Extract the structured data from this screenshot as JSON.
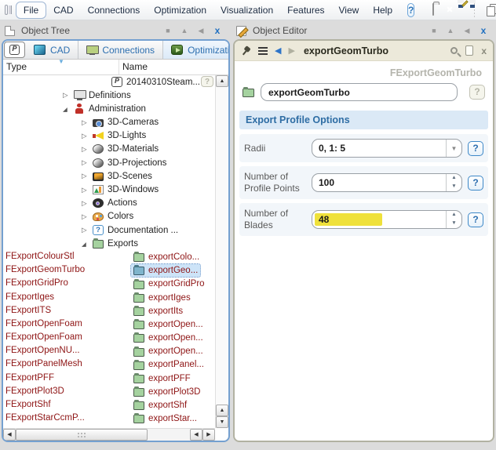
{
  "menu": {
    "items": [
      {
        "label": "File",
        "boxed": true
      },
      {
        "label": "CAD"
      },
      {
        "label": "Connections"
      },
      {
        "label": "Optimization"
      },
      {
        "label": "Visualization"
      },
      {
        "label": "Features"
      },
      {
        "label": "View"
      },
      {
        "label": "Help"
      }
    ],
    "icons": [
      "window-panel",
      "help",
      "new-project",
      "close-session",
      "save",
      "save-as",
      "copy-object"
    ]
  },
  "tree_panel": {
    "title": "Object Tree",
    "tabs": [
      {
        "label": "",
        "icon": "project-p"
      },
      {
        "label": "CAD",
        "icon": "cad"
      },
      {
        "label": "Connections",
        "icon": "connections-monitor"
      },
      {
        "label": "Optimization",
        "icon": "optimization-play"
      }
    ],
    "columns": {
      "type": "Type",
      "name": "Name"
    },
    "items": [
      {
        "type": "",
        "name": "20140310Steam...",
        "icon": "i-pbadge",
        "arrow": "",
        "indent": 124,
        "nameClass": "",
        "selClass": "",
        "help": true
      },
      {
        "type": "",
        "name": "Definitions",
        "icon": "i-monitor",
        "arrow": "c",
        "indent": 76,
        "nameClass": "",
        "selClass": "",
        "help": false
      },
      {
        "type": "",
        "name": "Administration",
        "icon": "i-person",
        "arrow": "e",
        "indent": 76,
        "nameClass": "",
        "selClass": "",
        "help": false
      },
      {
        "type": "",
        "name": "3D-Cameras",
        "icon": "i-camera",
        "arrow": "c",
        "indent": 100,
        "nameClass": "",
        "selClass": "",
        "help": false
      },
      {
        "type": "",
        "name": "3D-Lights",
        "icon": "i-light",
        "arrow": "c",
        "indent": 100,
        "nameClass": "",
        "selClass": "",
        "help": false
      },
      {
        "type": "",
        "name": "3D-Materials",
        "icon": "i-sphere",
        "arrow": "c",
        "indent": 100,
        "nameClass": "",
        "selClass": "",
        "help": false
      },
      {
        "type": "",
        "name": "3D-Projections",
        "icon": "i-sphere",
        "arrow": "c",
        "indent": 100,
        "nameClass": "",
        "selClass": "",
        "help": false
      },
      {
        "type": "",
        "name": "3D-Scenes",
        "icon": "i-scene",
        "arrow": "c",
        "indent": 100,
        "nameClass": "",
        "selClass": "",
        "help": false
      },
      {
        "type": "",
        "name": "3D-Windows",
        "icon": "i-chart",
        "arrow": "c",
        "indent": 100,
        "nameClass": "",
        "selClass": "",
        "help": false
      },
      {
        "type": "",
        "name": "Actions",
        "icon": "i-action",
        "arrow": "c",
        "indent": 100,
        "nameClass": "",
        "selClass": "",
        "help": false
      },
      {
        "type": "",
        "name": "Colors",
        "icon": "i-palette",
        "arrow": "c",
        "indent": 100,
        "nameClass": "",
        "selClass": "",
        "help": false
      },
      {
        "type": "",
        "name": "Documentation ...",
        "icon": "i-helpbadge",
        "arrow": "c",
        "indent": 100,
        "nameClass": "",
        "selClass": "",
        "help": false
      },
      {
        "type": "",
        "name": "Exports",
        "icon": "i-folder",
        "arrow": "e",
        "indent": 100,
        "nameClass": "",
        "selClass": "",
        "help": false
      },
      {
        "type": "FExportColourStl",
        "name": "exportColo...",
        "icon": "i-folder",
        "arrow": "",
        "indent": 152,
        "nameClass": "maroon",
        "selClass": "",
        "help": false
      },
      {
        "type": "FExportGeomTurbo",
        "name": "exportGeo...",
        "icon": "i-folder-sel",
        "arrow": "",
        "indent": 152,
        "nameClass": "maroon",
        "selClass": "sel",
        "help": false
      },
      {
        "type": "FExportGridPro",
        "name": "exportGridPro",
        "icon": "i-folder",
        "arrow": "",
        "indent": 152,
        "nameClass": "maroon",
        "selClass": "",
        "help": false
      },
      {
        "type": "FExportIges",
        "name": "exportIges",
        "icon": "i-folder",
        "arrow": "",
        "indent": 152,
        "nameClass": "maroon",
        "selClass": "",
        "help": false
      },
      {
        "type": "FExportITS",
        "name": "exportIts",
        "icon": "i-folder",
        "arrow": "",
        "indent": 152,
        "nameClass": "maroon",
        "selClass": "",
        "help": false
      },
      {
        "type": "FExportOpenFoam",
        "name": "exportOpen...",
        "icon": "i-folder",
        "arrow": "",
        "indent": 152,
        "nameClass": "maroon",
        "selClass": "",
        "help": false
      },
      {
        "type": "FExportOpenFoam",
        "name": "exportOpen...",
        "icon": "i-folder",
        "arrow": "",
        "indent": 152,
        "nameClass": "maroon",
        "selClass": "",
        "help": false
      },
      {
        "type": "FExportOpenNU...",
        "name": "exportOpen...",
        "icon": "i-folder",
        "arrow": "",
        "indent": 152,
        "nameClass": "maroon",
        "selClass": "",
        "help": false
      },
      {
        "type": "FExportPanelMesh",
        "name": "exportPanel...",
        "icon": "i-folder",
        "arrow": "",
        "indent": 152,
        "nameClass": "maroon",
        "selClass": "",
        "help": false
      },
      {
        "type": "FExportPFF",
        "name": "exportPFF",
        "icon": "i-folder",
        "arrow": "",
        "indent": 152,
        "nameClass": "maroon",
        "selClass": "",
        "help": false
      },
      {
        "type": "FExportPlot3D",
        "name": "exportPlot3D",
        "icon": "i-folder",
        "arrow": "",
        "indent": 152,
        "nameClass": "maroon",
        "selClass": "",
        "help": false
      },
      {
        "type": "FExportShf",
        "name": "exportShf",
        "icon": "i-folder",
        "arrow": "",
        "indent": 152,
        "nameClass": "maroon",
        "selClass": "",
        "help": false
      },
      {
        "type": "FExportStarCcmP...",
        "name": "exportStar...",
        "icon": "i-folder",
        "arrow": "",
        "indent": 152,
        "nameClass": "maroon",
        "selClass": "",
        "help": false
      }
    ]
  },
  "editor_panel": {
    "title": "Object Editor",
    "toolbar_title": "exportGeomTurbo",
    "class_label": "FExportGeomTurbo",
    "name_value": "exportGeomTurbo",
    "section_title": "Export Profile Options",
    "fields": [
      {
        "label": "Radii",
        "value": "0, 1: 5",
        "control": "combo"
      },
      {
        "label": "Number of Profile Points",
        "value": "100",
        "control": "spin"
      },
      {
        "label": "Number of Blades",
        "value": "48",
        "control": "spin",
        "highlighted": true
      }
    ]
  },
  "colors": {
    "accent_blue": "#2e6da4",
    "selection_blue": "#cde4f8",
    "type_text_maroon": "#8e1414",
    "highlight_yellow": "#efe13b",
    "toolbar_beige": "#ece9da",
    "panel_border_blue": "#74a0d0"
  }
}
